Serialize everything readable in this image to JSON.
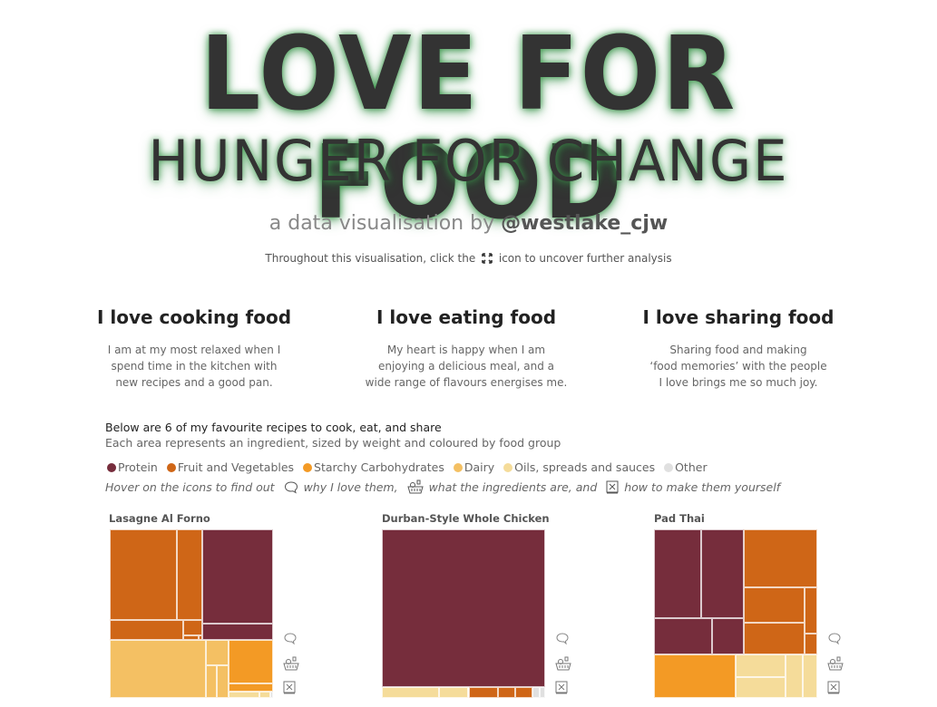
{
  "header": {
    "title": "LOVE FOR FOOD",
    "subtitle": "HUNGER FOR CHANGE",
    "byline_prefix": "a data visualisation by ",
    "byline_handle": "@westlake_cjw",
    "hint_before": "Throughout this visualisation, click the",
    "hint_icon": "expand-icon",
    "hint_after": "icon to uncover further analysis"
  },
  "columns": [
    {
      "title": "I love cooking food",
      "text": "I am at my most relaxed when I\nspend time in the kitchen with\nnew recipes and a good pan."
    },
    {
      "title": "I love eating food",
      "text": "My heart is happy when I am\nenjoying a delicious meal, and a\nwide range of flavours energises me."
    },
    {
      "title": "I love sharing food",
      "text": "Sharing food and making\n‘food memories’ with the people\nI love brings me so much joy."
    }
  ],
  "intro": {
    "line1": "Below are 6 of my favourite recipes to cook, eat, and share",
    "line2": "Each area represents an ingredient, sized by weight and coloured by food group"
  },
  "legend": [
    {
      "label": "Protein",
      "color": "#762d3c"
    },
    {
      "label": "Fruit and Vegetables",
      "color": "#cf6617"
    },
    {
      "label": "Starchy Carbohydrates",
      "color": "#f39a25"
    },
    {
      "label": "Dairy",
      "color": "#f4c063"
    },
    {
      "label": "Oils, spreads and sauces",
      "color": "#f5dc9a"
    },
    {
      "label": "Other",
      "color": "#e0e0e0"
    }
  ],
  "hover_hint": {
    "prefix": "Hover on the icons to find out",
    "why": "why I love them,",
    "ingredients": "what the ingredients are, and",
    "how": "how to make them yourself",
    "icons": [
      "speech-bubble-icon",
      "basket-icon",
      "recipe-book-icon"
    ]
  },
  "recipes": [
    {
      "title": "Lasagne Al Forno"
    },
    {
      "title": "Durban-Style Whole Chicken"
    },
    {
      "title": "Pad Thai"
    }
  ]
}
